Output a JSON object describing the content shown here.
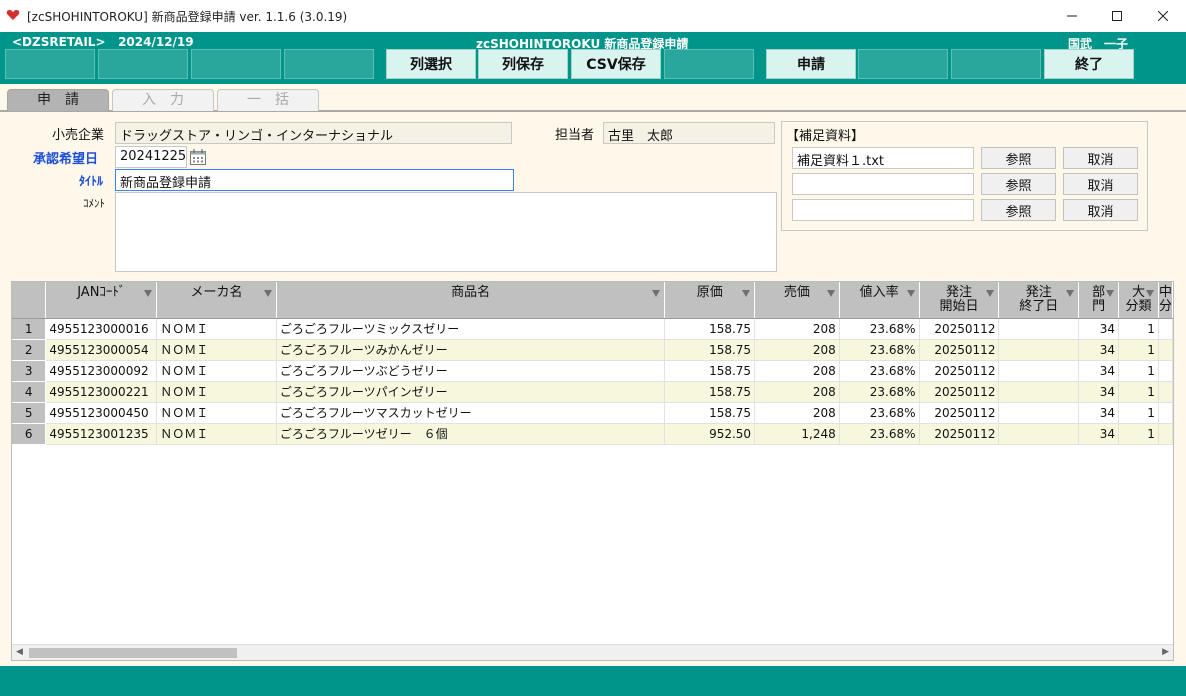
{
  "window": {
    "title": "[zcSHOHINTOROKU] 新商品登録申請 ver. 1.1.6 (3.0.19)"
  },
  "header": {
    "system": "<DZSRETAIL>",
    "date": "2024/12/19",
    "screen_title": "zcSHOHINTOROKU  新商品登録申請",
    "user": "国武　一子"
  },
  "function_keys": {
    "f5": "列選択",
    "f6": "列保存",
    "f7": "CSV保存",
    "f9": "申請",
    "f12": "終了"
  },
  "tabs": [
    "申請",
    "入力",
    "一括"
  ],
  "form": {
    "retailer_label": "小売企業",
    "retailer_value": "ドラッグストア・リンゴ・インターナショナル",
    "staff_label": "担当者",
    "staff_value": "古里　太郎",
    "desired_date_label": "承認希望日",
    "desired_date_value": "20241225",
    "title_label": "ﾀｲﾄﾙ",
    "title_value": "新商品登録申請",
    "comment_label": "ｺﾒﾝﾄ",
    "comment_value": ""
  },
  "attachments": {
    "title": "【補足資料】",
    "files": [
      "補足資料１.txt",
      "",
      ""
    ],
    "browse_label": "参照",
    "cancel_label": "取消"
  },
  "grid": {
    "columns": [
      "",
      "JANｺｰﾄﾞ",
      "メーカ名",
      "商品名",
      "原価",
      "売価",
      "値入率",
      "発注\n開始日",
      "発注\n終了日",
      "部\n門",
      "大\n分類",
      "中\n分"
    ],
    "rows": [
      [
        "1",
        "4955123000016",
        "ＮＯＭＩ",
        "ごろごろフルーツミックスゼリー",
        "158.75",
        "208",
        "23.68%",
        "20250112",
        "",
        "34",
        "1",
        ""
      ],
      [
        "2",
        "4955123000054",
        "ＮＯＭＩ",
        "ごろごろフルーツみかんゼリー",
        "158.75",
        "208",
        "23.68%",
        "20250112",
        "",
        "34",
        "1",
        ""
      ],
      [
        "3",
        "4955123000092",
        "ＮＯＭＩ",
        "ごろごろフルーツぶどうゼリー",
        "158.75",
        "208",
        "23.68%",
        "20250112",
        "",
        "34",
        "1",
        ""
      ],
      [
        "4",
        "4955123000221",
        "ＮＯＭＩ",
        "ごろごろフルーツパインゼリー",
        "158.75",
        "208",
        "23.68%",
        "20250112",
        "",
        "34",
        "1",
        ""
      ],
      [
        "5",
        "4955123000450",
        "ＮＯＭＩ",
        "ごろごろフルーツマスカットゼリー",
        "158.75",
        "208",
        "23.68%",
        "20250112",
        "",
        "34",
        "1",
        ""
      ],
      [
        "6",
        "4955123001235",
        "ＮＯＭＩ",
        "ごろごろフルーツゼリー　６個",
        "952.50",
        "1,248",
        "23.68%",
        "20250112",
        "",
        "34",
        "1",
        ""
      ]
    ]
  },
  "colors": {
    "toolbar": "#00958a",
    "background": "#fdf8ea",
    "row_alt": "#f7f7de",
    "header_gray": "#c0c0c0",
    "label_blue": "#1d4ed8"
  },
  "icons": [
    "app-heart-icon",
    "minimize-icon",
    "maximize-icon",
    "close-icon",
    "calendar-icon",
    "filter-icon"
  ]
}
